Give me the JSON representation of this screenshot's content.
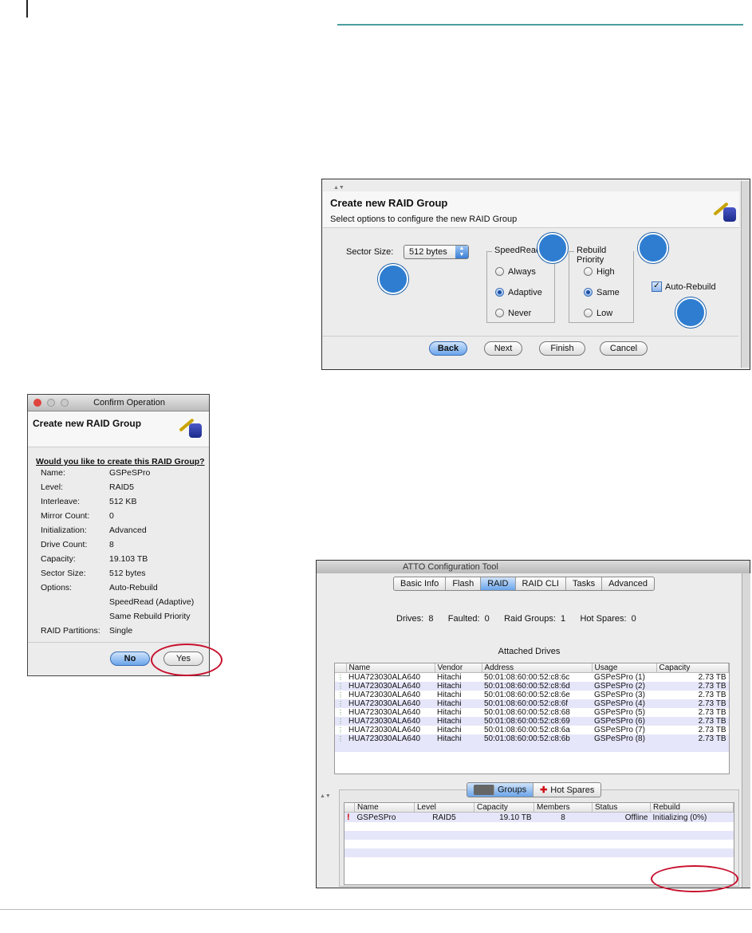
{
  "wizard": {
    "title": "Create new RAID Group",
    "subtitle": "Select options to configure the new RAID Group",
    "sector_label": "Sector Size:",
    "sector_value": "512 bytes",
    "speedread_legend": "SpeedRead",
    "speedread_options": [
      "Always",
      "Adaptive",
      "Never"
    ],
    "rebuild_legend": "Rebuild Priority",
    "rebuild_options": [
      "High",
      "Same",
      "Low"
    ],
    "auto_rebuild": "Auto-Rebuild",
    "buttons": {
      "back": "Back",
      "next": "Next",
      "finish": "Finish",
      "cancel": "Cancel"
    }
  },
  "confirm": {
    "window_title": "Confirm Operation",
    "title": "Create new RAID Group",
    "question": "Would you like to create this RAID Group?",
    "rows": [
      {
        "k": "Name:",
        "v": "GSPeSPro"
      },
      {
        "k": "Level:",
        "v": "RAID5"
      },
      {
        "k": "Interleave:",
        "v": "512 KB"
      },
      {
        "k": "Mirror Count:",
        "v": "0"
      },
      {
        "k": "Initialization:",
        "v": "Advanced"
      },
      {
        "k": "Drive Count:",
        "v": "8"
      },
      {
        "k": "Capacity:",
        "v": "19.103 TB"
      },
      {
        "k": "Sector Size:",
        "v": "512 bytes"
      },
      {
        "k": "Options:",
        "v": "Auto-Rebuild"
      },
      {
        "k": "",
        "v": "SpeedRead (Adaptive)"
      },
      {
        "k": "",
        "v": "Same Rebuild Priority"
      },
      {
        "k": "RAID Partitions:",
        "v": "Single"
      }
    ],
    "no": "No",
    "yes": "Yes"
  },
  "tool": {
    "window_title": "ATTO Configuration Tool",
    "tabs": [
      "Basic Info",
      "Flash",
      "RAID",
      "RAID CLI",
      "Tasks",
      "Advanced"
    ],
    "selected_tab": "RAID",
    "summary": "Drives:  8      Faulted:  0      Raid Groups:  1      Hot Spares:  0",
    "drives_heading": "Attached Drives",
    "drive_headers": [
      "Name",
      "Vendor",
      "Address",
      "Usage",
      "Capacity"
    ],
    "drives": [
      [
        "HUA723030ALA640",
        "Hitachi",
        "50:01:08:60:00:52:c8:6c",
        "GSPeSPro (1)",
        "2.73 TB"
      ],
      [
        "HUA723030ALA640",
        "Hitachi",
        "50:01:08:60:00:52:c8:6d",
        "GSPeSPro (2)",
        "2.73 TB"
      ],
      [
        "HUA723030ALA640",
        "Hitachi",
        "50:01:08:60:00:52:c8:6e",
        "GSPeSPro (3)",
        "2.73 TB"
      ],
      [
        "HUA723030ALA640",
        "Hitachi",
        "50:01:08:60:00:52:c8:6f",
        "GSPeSPro (4)",
        "2.73 TB"
      ],
      [
        "HUA723030ALA640",
        "Hitachi",
        "50:01:08:60:00:52:c8:68",
        "GSPeSPro (5)",
        "2.73 TB"
      ],
      [
        "HUA723030ALA640",
        "Hitachi",
        "50:01:08:60:00:52:c8:69",
        "GSPeSPro (6)",
        "2.73 TB"
      ],
      [
        "HUA723030ALA640",
        "Hitachi",
        "50:01:08:60:00:52:c8:6a",
        "GSPeSPro (7)",
        "2.73 TB"
      ],
      [
        "HUA723030ALA640",
        "Hitachi",
        "50:01:08:60:00:52:c8:6b",
        "GSPeSPro (8)",
        "2.73 TB"
      ]
    ],
    "group_tabs": {
      "groups": "Groups",
      "hot_spares": "Hot Spares"
    },
    "group_headers": [
      "Name",
      "Level",
      "Capacity",
      "Members",
      "Status",
      "Rebuild"
    ],
    "group_row": [
      "GSPeSPro",
      "RAID5",
      "19.10 TB",
      "8",
      "Offline",
      "Initializing (0%)"
    ]
  },
  "colors": {
    "accent": "#2e7dd1",
    "callout": "#c8102e",
    "rule": "#4a9f9f"
  }
}
